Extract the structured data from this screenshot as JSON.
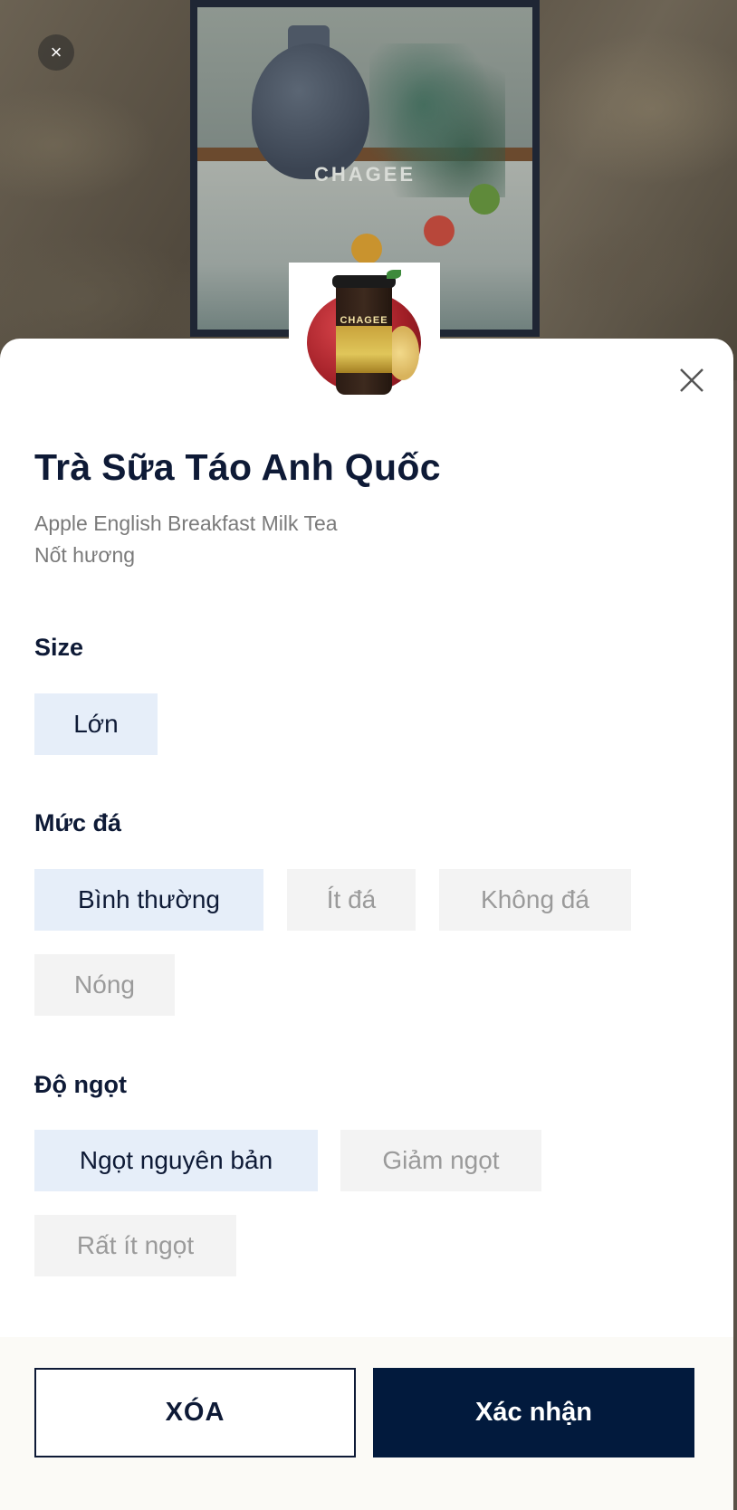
{
  "backdrop": {
    "close_icon": "close-icon",
    "poster_brand": "CHAGEE"
  },
  "product": {
    "thumb_brand": "CHAGEE",
    "name": "Trà Sữa Táo Anh Quốc",
    "english_name": "Apple English Breakfast Milk Tea",
    "note": "Nốt hương"
  },
  "sheet": {
    "close_icon": "close-icon"
  },
  "sections": {
    "size": {
      "label": "Size",
      "options": [
        "Lớn"
      ],
      "selected": "Lớn"
    },
    "ice": {
      "label": "Mức đá",
      "options": [
        "Bình thường",
        "Ít đá",
        "Không đá",
        "Nóng"
      ],
      "selected": "Bình thường"
    },
    "sweetness": {
      "label": "Độ ngọt",
      "options": [
        "Ngọt nguyên bản",
        "Giảm ngọt",
        "Rất ít ngọt"
      ],
      "selected": "Ngọt nguyên bản"
    }
  },
  "footer": {
    "clear_label": "XÓA",
    "confirm_label": "Xác nhận"
  },
  "colors": {
    "primary_navy": "#021a3d",
    "selected_chip_bg": "#e6eef9",
    "unselected_chip_bg": "#f3f3f3"
  }
}
